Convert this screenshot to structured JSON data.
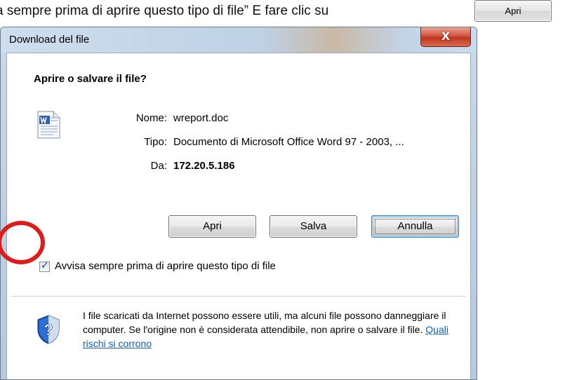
{
  "doc": {
    "instruction_text": "a sempre prima di aprire questo tipo di file” E fare clic su",
    "open_button_label": "Apri"
  },
  "dialog": {
    "title": "Download del file",
    "close_label": "X",
    "heading": "Aprire o salvare il file?",
    "file": {
      "name_label": "Nome:",
      "name_value": "wreport.doc",
      "type_label": "Tipo:",
      "type_value": "Documento di Microsoft Office Word 97 - 2003, ...",
      "from_label": "Da:",
      "from_value": "172.20.5.186"
    },
    "buttons": {
      "open": "Apri",
      "save": "Salva",
      "cancel": "Annulla"
    },
    "checkbox": {
      "label": "Avvisa sempre prima di aprire questo tipo di file",
      "checked": true
    },
    "warning": {
      "text": "I file scaricati da Internet possono essere utili, ma alcuni file possono danneggiare il computer. Se l'origine non è considerata attendibile, non aprire o salvare il file.",
      "link": "Quali rischi si corrono"
    }
  },
  "icons": {
    "file_icon": "word-document-icon",
    "warning_icon": "shield-question-icon"
  },
  "colors": {
    "highlight_circle": "#e01b1b",
    "link": "#0a5fc1"
  }
}
